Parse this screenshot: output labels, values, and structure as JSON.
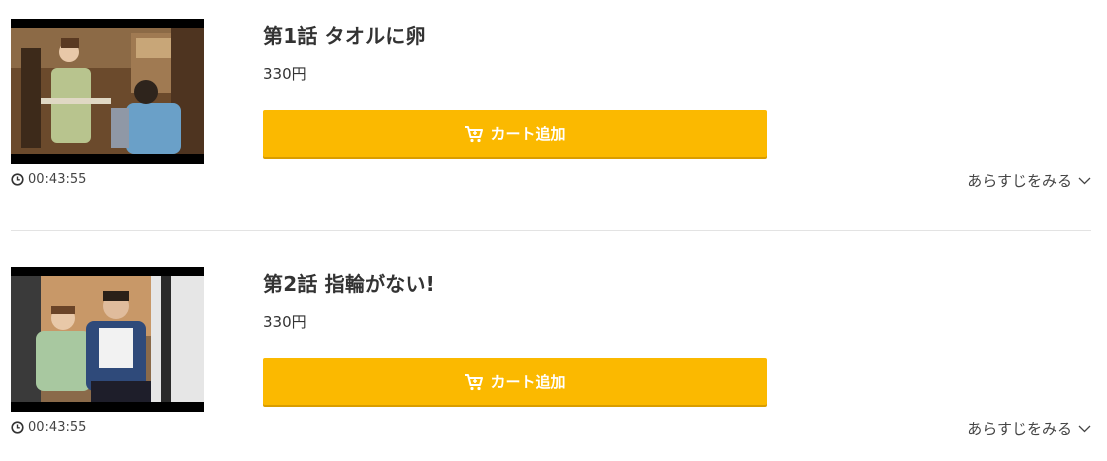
{
  "episodes": [
    {
      "title": "第1話 タオルに卵",
      "price": "330円",
      "cart_label": "カート追加",
      "duration": "00:43:55",
      "synopsis_label": "あらすじをみる"
    },
    {
      "title": "第2話 指輪がない!",
      "price": "330円",
      "cart_label": "カート追加",
      "duration": "00:43:55",
      "synopsis_label": "あらすじをみる"
    }
  ],
  "colors": {
    "cart_button": "#fbb900",
    "text": "#333333",
    "divider": "#e3e3e3"
  },
  "icons": [
    "cart-icon",
    "clock-icon",
    "chevron-down-icon"
  ]
}
